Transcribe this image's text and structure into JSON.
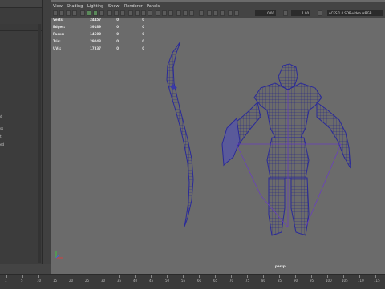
{
  "viewport": {
    "menus": [
      "View",
      "Shading",
      "Lighting",
      "Show",
      "Renderer",
      "Panels"
    ],
    "toolbar": {
      "field1": "0.00",
      "field2": "1.00",
      "colorspace": "ACES 1.0 SDR-video (sRGB"
    },
    "hud": [
      {
        "label": "Verts:",
        "v1": "24457",
        "v2": "0",
        "v3": "0"
      },
      {
        "label": "Edges:",
        "v1": "39189",
        "v2": "0",
        "v3": "0"
      },
      {
        "label": "Faces:",
        "v1": "14600",
        "v2": "0",
        "v3": "0"
      },
      {
        "label": "Tris:",
        "v1": "29043",
        "v2": "0",
        "v3": "0"
      },
      {
        "label": "UVs:",
        "v1": "17337",
        "v2": "0",
        "v3": "0"
      }
    ],
    "camera_label": "persp"
  },
  "left_panel": {
    "fragments": [
      "d",
      "ss",
      "t",
      "ed"
    ]
  },
  "timeline": {
    "labels": [
      "1",
      "5",
      "10",
      "15",
      "20",
      "25",
      "30",
      "35",
      "40",
      "45",
      "50",
      "55",
      "60",
      "65",
      "70",
      "75",
      "80",
      "85",
      "90",
      "95",
      "100",
      "105",
      "110",
      "115"
    ]
  },
  "colors": {
    "viewport_bg": "#6b6b6b",
    "wireframe": "#1a1a7a",
    "wire_highlight": "#6a3fbf",
    "ui_dark": "#444444"
  }
}
